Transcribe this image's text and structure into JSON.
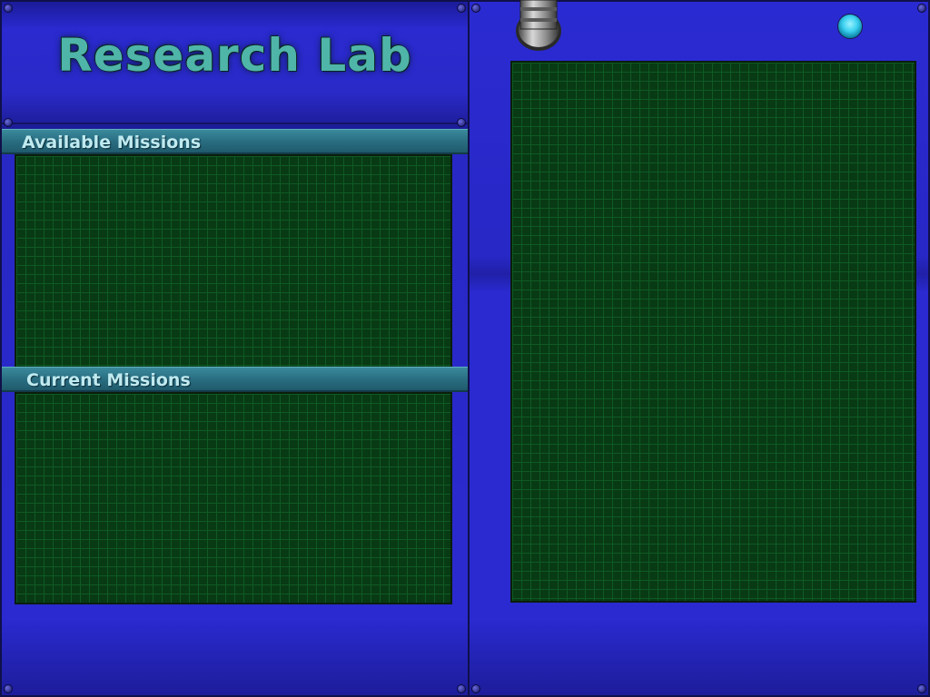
{
  "header": {
    "title": "Research Lab"
  },
  "sections": {
    "available": {
      "label": "Available Missions"
    },
    "current": {
      "label": "Current Missions"
    }
  },
  "colors": {
    "panel": "#2a2ad0",
    "grid": "#083a14",
    "section_bar": "#2a6e82",
    "title_text": "#4fb5a8",
    "knob": "#3ad0f0"
  }
}
